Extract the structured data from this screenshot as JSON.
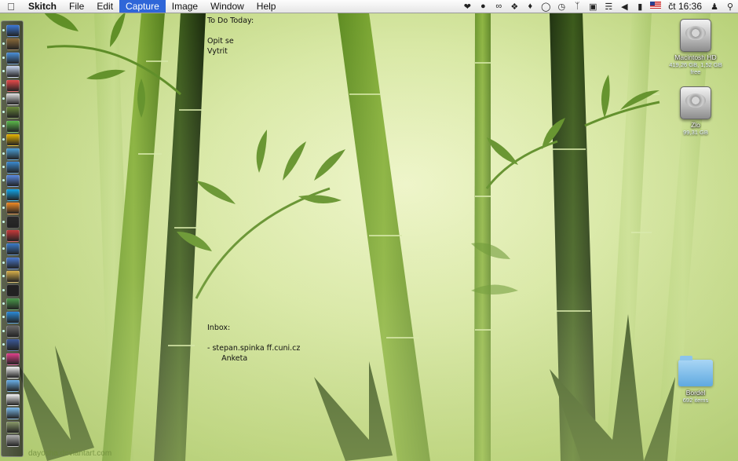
{
  "menubar": {
    "app_name": "Skitch",
    "menus": [
      "File",
      "Edit",
      "Capture",
      "Image",
      "Window",
      "Help"
    ],
    "active_menu": "Capture",
    "clock": "čt 16:36",
    "tray_icons": [
      "status-icon",
      "record-icon",
      "cs-icon",
      "dropbox-icon",
      "evernote-icon",
      "chat-icon",
      "time-machine-icon",
      "bluetooth-icon",
      "display-icon",
      "wifi-icon",
      "volume-icon",
      "battery-icon",
      "us-flag-icon",
      "user-icon",
      "spotlight-icon"
    ]
  },
  "notes": {
    "todo_lines": [
      "To Do Today:",
      "",
      "Opit se",
      "Vytrit"
    ],
    "inbox_lines": [
      "Inbox:",
      "",
      "- stepan.spinka ff.cuni.cz",
      "      Anketa"
    ]
  },
  "desktop_icons": [
    {
      "name": "Macintosh HD",
      "sub": "419,26 GB, 1,52 GB free",
      "type": "drive"
    },
    {
      "name": "Zlo",
      "sub": "99,31 GB",
      "type": "drive"
    },
    {
      "name": "Bordel",
      "sub": "692 items",
      "type": "folder"
    }
  ],
  "dock_icons": [
    {
      "name": "finder-icon",
      "color": "#3b78d8"
    },
    {
      "name": "launchpad-icon",
      "color": "#8a6a3a"
    },
    {
      "name": "safari-icon",
      "color": "#4a90d9"
    },
    {
      "name": "mail-icon",
      "color": "#c8d8f0"
    },
    {
      "name": "reminders-icon",
      "color": "#e84a4a"
    },
    {
      "name": "calendar-icon",
      "color": "#e0e0e0"
    },
    {
      "name": "iphoto-icon",
      "color": "#6a8a3a"
    },
    {
      "name": "evernote-icon",
      "color": "#5bb84a"
    },
    {
      "name": "chrome-icon",
      "color": "#e7b400"
    },
    {
      "name": "network-icon",
      "color": "#4aa0d8"
    },
    {
      "name": "globe-icon",
      "color": "#3a8ad0"
    },
    {
      "name": "messages-icon",
      "color": "#5a8ae0"
    },
    {
      "name": "skype-icon",
      "color": "#12a5e8"
    },
    {
      "name": "rss-icon",
      "color": "#f08a24"
    },
    {
      "name": "activity-monitor-icon",
      "color": "#2a2a2a"
    },
    {
      "name": "photo-booth-icon",
      "color": "#c83a3a"
    },
    {
      "name": "world-icon",
      "color": "#3a7ac8"
    },
    {
      "name": "xcode-icon",
      "color": "#4a7ad0"
    },
    {
      "name": "preview-icon",
      "color": "#d8b04a"
    },
    {
      "name": "terminal-icon",
      "color": "#222222"
    },
    {
      "name": "pen-icon",
      "color": "#4a9a4a"
    },
    {
      "name": "app-store-icon",
      "color": "#2a8ad8"
    },
    {
      "name": "utility-icon",
      "color": "#6a6a6a"
    },
    {
      "name": "facebook-icon",
      "color": "#3b5998"
    },
    {
      "name": "heart-icon",
      "color": "#e0408a"
    },
    {
      "name": "document-icon",
      "color": "#f0f0f0"
    },
    {
      "name": "folder-icon",
      "color": "#6ab0e8"
    },
    {
      "name": "page-icon",
      "color": "#f5f5f5"
    },
    {
      "name": "downloads-icon",
      "color": "#7ab8e8"
    },
    {
      "name": "stack-icon",
      "color": "#8a9a6a"
    },
    {
      "name": "trash-icon",
      "color": "#b0b0b0"
    }
  ],
  "watermark": "dayosha.deviantart.com",
  "colors": {
    "menu_active": "#2f66d8",
    "bamboo_dark": "#2a3f12",
    "bamboo_mid": "#5d8a24",
    "bamboo_light": "#a8c868"
  }
}
